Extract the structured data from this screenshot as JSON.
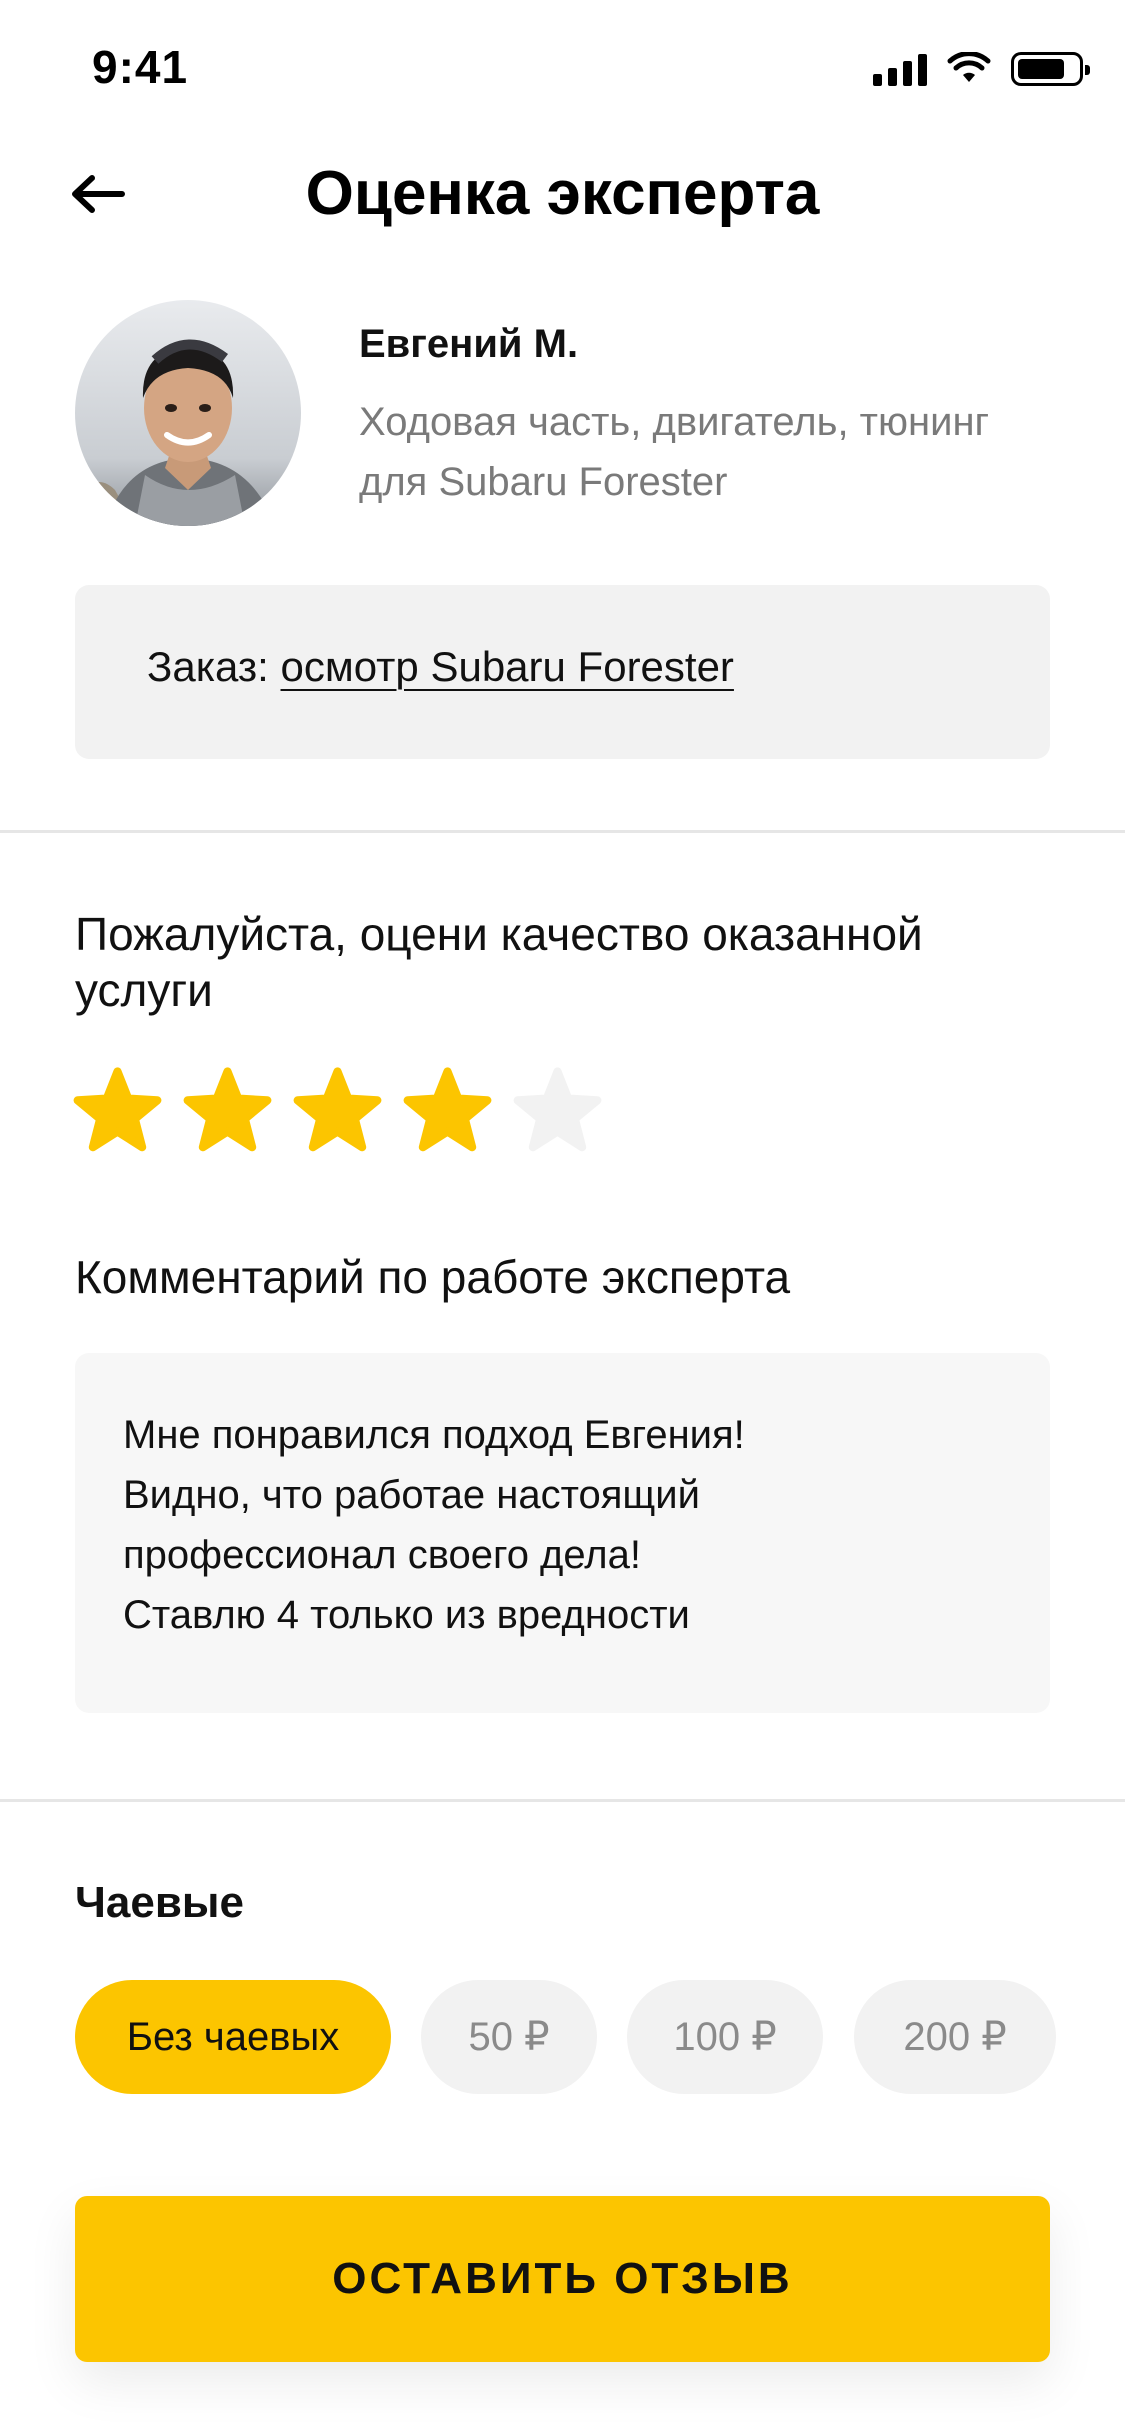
{
  "status_bar": {
    "time": "9:41"
  },
  "header": {
    "title": "Оценка эксперта"
  },
  "expert": {
    "name": "Евгений М.",
    "specialization": "Ходовая часть, двигатель, тюнинг для Subaru Forester"
  },
  "order": {
    "label": "Заказ:",
    "link_text": "осмотр Subaru Forester"
  },
  "rating": {
    "question": "Пожалуйста, оцени качество оказанной услуги",
    "value": 4,
    "max": 5,
    "filled_color": "#FCC500",
    "empty_color": "#F2F2F2"
  },
  "comment": {
    "label": "Комментарий по работе эксперта",
    "text": "Мне понравился подход Евгения!\nВидно, что работае настоящий\nпрофессионал своего дела!\nСтавлю 4 только из вредности"
  },
  "tips": {
    "title": "Чаевые",
    "options": [
      "Без чаевых",
      "50 ₽",
      "100 ₽",
      "200 ₽"
    ],
    "selected_index": 0
  },
  "submit": {
    "label": "ОСТАВИТЬ ОТЗЫВ"
  },
  "colors": {
    "accent": "#FCC500",
    "muted_text": "#7A7A7A",
    "surface": "#F2F2F2"
  }
}
